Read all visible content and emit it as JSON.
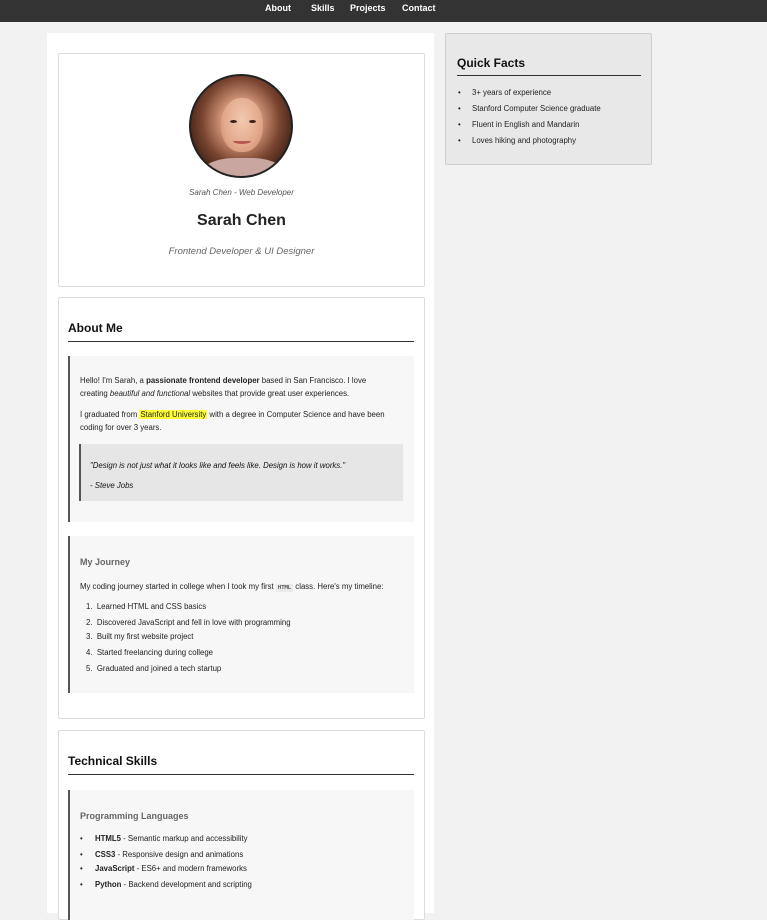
{
  "nav": {
    "items": [
      "About",
      "Skills",
      "Projects",
      "Contact"
    ]
  },
  "profile": {
    "caption": "Sarah Chen - Web Developer",
    "name": "Sarah Chen",
    "tagline": "Frontend Developer & UI Designer"
  },
  "about": {
    "title": "About Me",
    "p1": {
      "t1": "Hello! I'm Sarah, a ",
      "b1": "passionate frontend developer",
      "t2": " based in San Francisco. I love",
      "t3": "creating ",
      "i1": "beautiful and functional",
      "t4": " websites that provide great user experiences."
    },
    "p2": {
      "t1": "I graduated from ",
      "mark": "Stanford University",
      "t2": " with a degree in Computer Science and have been",
      "t3": "coding for over 3 years."
    },
    "quote": {
      "text": "\"Design is not just what it looks like and feels like. Design is how it works.\"",
      "author": "- Steve Jobs"
    },
    "journey": {
      "title": "My Journey",
      "intro1": "My coding journey started in college when I took my first ",
      "code": "HTML",
      "intro2": " class. Here's my timeline:",
      "steps": [
        "Learned HTML and CSS basics",
        "Discovered JavaScript and fell in love with programming",
        "Built my first website project",
        "Started freelancing during college",
        "Graduated and joined a tech startup"
      ]
    }
  },
  "skills": {
    "title": "Technical Skills",
    "programming": {
      "title": "Programming Languages",
      "items": [
        {
          "name": "HTML5",
          "desc": " - Semantic markup and accessibility"
        },
        {
          "name": "CSS3",
          "desc": " - Responsive design and animations"
        },
        {
          "name": "JavaScript",
          "desc": " - ES6+ and modern frameworks"
        },
        {
          "name": "Python",
          "desc": " - Backend development and scripting"
        }
      ]
    }
  },
  "sidebar": {
    "title": "Quick Facts",
    "facts": [
      "3+ years of experience",
      "Stanford Computer Science graduate",
      "Fluent in English and Mandarin",
      "Loves hiking and photography"
    ]
  }
}
